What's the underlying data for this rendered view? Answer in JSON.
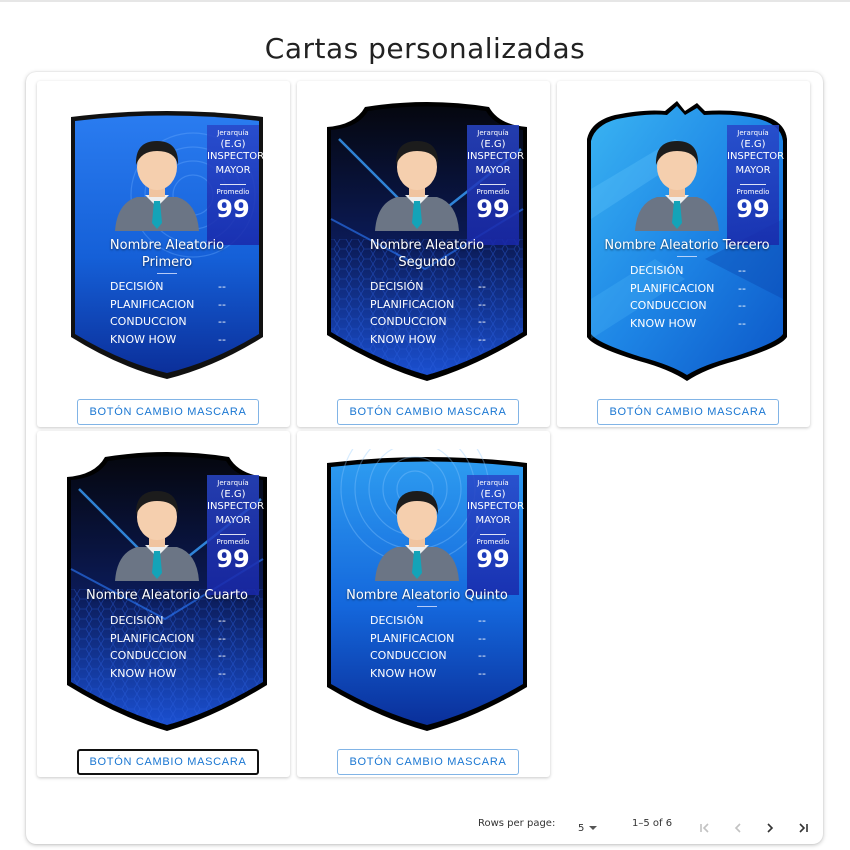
{
  "page": {
    "title": "Cartas personalizadas"
  },
  "cards": [
    {
      "name_line1": "Nombre Aleatorio",
      "name_line2": "Primero",
      "style": "blue-shield",
      "rank_label": "Jerarquía",
      "rank_abbr": "(E.G)",
      "rank_line1": "INSPECTOR",
      "rank_line2": "MAYOR",
      "avg_label": "Promedio",
      "avg_value": "99",
      "stats": [
        {
          "label": "DECISIÓN",
          "value": "--"
        },
        {
          "label": "PLANIFICACION",
          "value": "--"
        },
        {
          "label": "CONDUCCION",
          "value": "--"
        },
        {
          "label": "KNOW HOW",
          "value": "--"
        }
      ],
      "button": "BOTÓN CAMBIO MASCARA"
    },
    {
      "name_line1": "Nombre Aleatorio",
      "name_line2": "Segundo",
      "style": "dark-hex",
      "rank_label": "Jerarquía",
      "rank_abbr": "(E.G)",
      "rank_line1": "INSPECTOR",
      "rank_line2": "MAYOR",
      "avg_label": "Promedio",
      "avg_value": "99",
      "stats": [
        {
          "label": "DECISIÓN",
          "value": "--"
        },
        {
          "label": "PLANIFICACION",
          "value": "--"
        },
        {
          "label": "CONDUCCION",
          "value": "--"
        },
        {
          "label": "KNOW HOW",
          "value": "--"
        }
      ],
      "button": "BOTÓN CAMBIO MASCARA"
    },
    {
      "name_line1": "Nombre Aleatorio Tercero",
      "name_line2": "",
      "style": "light-blue",
      "rank_label": "Jerarquía",
      "rank_abbr": "(E.G)",
      "rank_line1": "INSPECTOR",
      "rank_line2": "MAYOR",
      "avg_label": "Promedio",
      "avg_value": "99",
      "stats": [
        {
          "label": "DECISIÓN",
          "value": "--"
        },
        {
          "label": "PLANIFICACION",
          "value": "--"
        },
        {
          "label": "CONDUCCION",
          "value": "--"
        },
        {
          "label": "KNOW HOW",
          "value": "--"
        }
      ],
      "button": "BOTÓN CAMBIO MASCARA"
    },
    {
      "name_line1": "Nombre Aleatorio Cuarto",
      "name_line2": "",
      "style": "dark-hex",
      "rank_label": "Jerarquía",
      "rank_abbr": "(E.G)",
      "rank_line1": "INSPECTOR",
      "rank_line2": "MAYOR",
      "avg_label": "Promedio",
      "avg_value": "99",
      "stats": [
        {
          "label": "DECISIÓN",
          "value": "--"
        },
        {
          "label": "PLANIFICACION",
          "value": "--"
        },
        {
          "label": "CONDUCCION",
          "value": "--"
        },
        {
          "label": "KNOW HOW",
          "value": "--"
        }
      ],
      "button": "BOTÓN CAMBIO MASCARA"
    },
    {
      "name_line1": "Nombre Aleatorio Quinto",
      "name_line2": "",
      "style": "blue-swirl",
      "rank_label": "Jerarquía",
      "rank_abbr": "(E.G)",
      "rank_line1": "INSPECTOR",
      "rank_line2": "MAYOR",
      "avg_label": "Promedio",
      "avg_value": "99",
      "stats": [
        {
          "label": "DECISIÓN",
          "value": "--"
        },
        {
          "label": "PLANIFICACION",
          "value": "--"
        },
        {
          "label": "CONDUCCION",
          "value": "--"
        },
        {
          "label": "KNOW HOW",
          "value": "--"
        }
      ],
      "button": "BOTÓN CAMBIO MASCARA"
    }
  ],
  "pagination": {
    "rows_label": "Rows per page:",
    "rows_value": "5",
    "range": "1–5 of 6"
  },
  "colors": {
    "accent": "#1976d2",
    "card_blue": "#1565e0",
    "card_dark": "#0a0f2e"
  }
}
